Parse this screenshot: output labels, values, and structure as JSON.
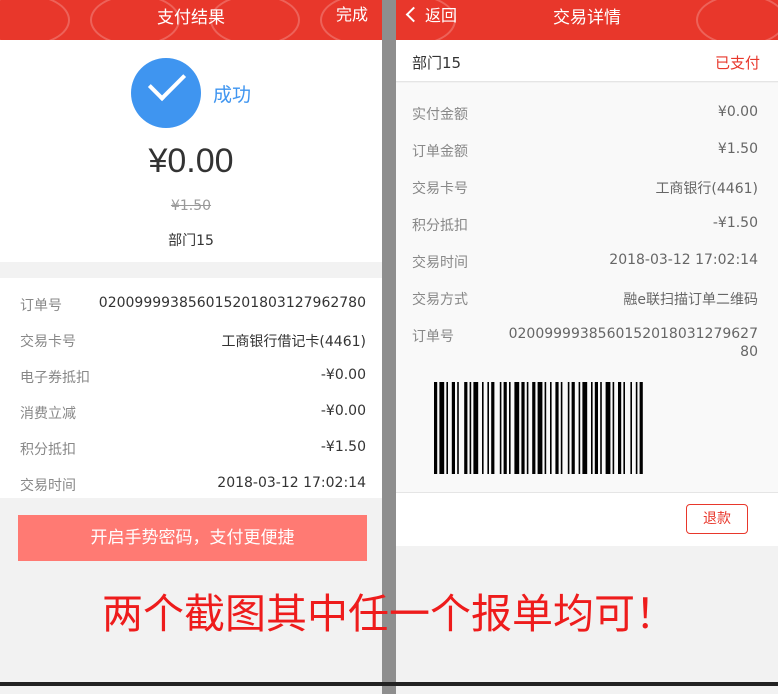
{
  "left": {
    "header": {
      "title": "支付结果",
      "done_label": "完成"
    },
    "result": {
      "status": "成功",
      "amount": "¥0.00",
      "original_amount": "¥1.50",
      "merchant": "部门15"
    },
    "details": [
      {
        "label": "订单号",
        "value": "020099993856015201803127962780"
      },
      {
        "label": "交易卡号",
        "value": "工商银行借记卡(4461)"
      },
      {
        "label": "电子券抵扣",
        "value": "-¥0.00"
      },
      {
        "label": "消费立减",
        "value": "-¥0.00"
      },
      {
        "label": "积分抵扣",
        "value": "-¥1.50"
      },
      {
        "label": "交易时间",
        "value": "2018-03-12 17:02:14"
      }
    ],
    "gesture_button": "开启手势密码，支付更便捷"
  },
  "right": {
    "header": {
      "back_label": "返回",
      "title": "交易详情"
    },
    "merchant": "部门15",
    "status": "已支付",
    "details": [
      {
        "label": "实付金额",
        "value": "¥0.00"
      },
      {
        "label": "订单金额",
        "value": "¥1.50"
      },
      {
        "label": "交易卡号",
        "value": "工商银行(4461)"
      },
      {
        "label": "积分抵扣",
        "value": "-¥1.50"
      },
      {
        "label": "交易时间",
        "value": "2018-03-12 17:02:14"
      },
      {
        "label": "交易方式",
        "value": "融e联扫描订单二维码"
      },
      {
        "label": "订单号",
        "value": "020099993856015201803127962780"
      }
    ],
    "refund_button": "退款"
  },
  "overlay_note": "两个截图其中任一个报单均可！",
  "colors": {
    "header": "#e8372b",
    "success": "#3f95f0",
    "button": "#ff7a73",
    "note": "#ee1c1c"
  }
}
